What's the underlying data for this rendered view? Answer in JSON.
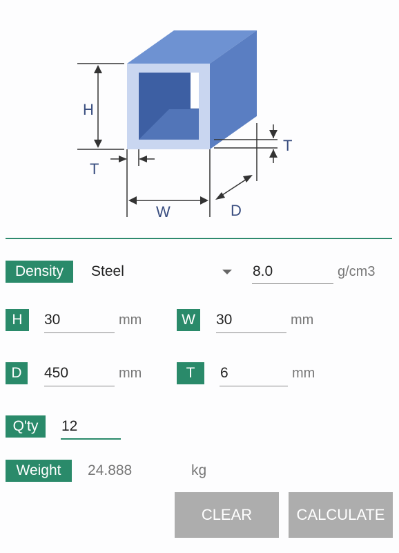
{
  "diagram": {
    "h_label": "H",
    "w_label": "W",
    "d_label": "D",
    "t_label_left": "T",
    "t_label_right": "T"
  },
  "density": {
    "label": "Density",
    "material": "Steel",
    "value": "8.0",
    "unit": "g/cm3"
  },
  "h": {
    "label": "H",
    "value": "30",
    "unit": "mm"
  },
  "w": {
    "label": "W",
    "value": "30",
    "unit": "mm"
  },
  "d": {
    "label": "D",
    "value": "450",
    "unit": "mm"
  },
  "t": {
    "label": "T",
    "value": "6",
    "unit": "mm"
  },
  "qty": {
    "label": "Q'ty",
    "value": "12"
  },
  "weight": {
    "label": "Weight",
    "value": "24.888",
    "unit": "kg"
  },
  "buttons": {
    "clear": "CLEAR",
    "calculate": "CALCULATE"
  },
  "colors": {
    "accent": "#2a8a6a",
    "tube_front": "#5b7fc2",
    "tube_top": "#6b8fd0",
    "tube_side": "#4a6cb0",
    "button": "#adadad"
  }
}
